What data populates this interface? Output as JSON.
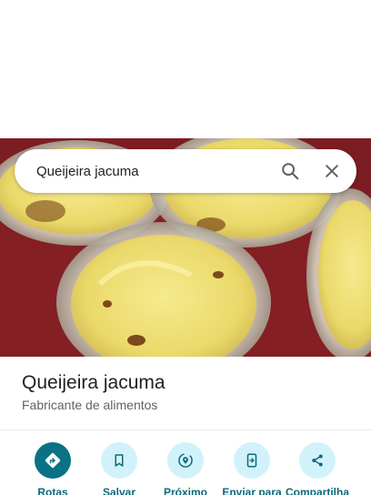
{
  "search": {
    "query": "Queijeira jacuma"
  },
  "place": {
    "title": "Queijeira jacuma",
    "category": "Fabricante de alimentos"
  },
  "actions": [
    {
      "label": "Rotas",
      "icon": "directions-icon"
    },
    {
      "label": "Salvar",
      "icon": "bookmark-icon"
    },
    {
      "label": "Próximo",
      "icon": "nearby-icon"
    },
    {
      "label": "Enviar para",
      "icon": "send-to-phone-icon"
    },
    {
      "label": "Compartilha",
      "icon": "share-icon"
    }
  ],
  "colors": {
    "primary_action": "#0b7285",
    "action_bg": "#d2f2fb",
    "action_label": "#0b6a7a"
  }
}
